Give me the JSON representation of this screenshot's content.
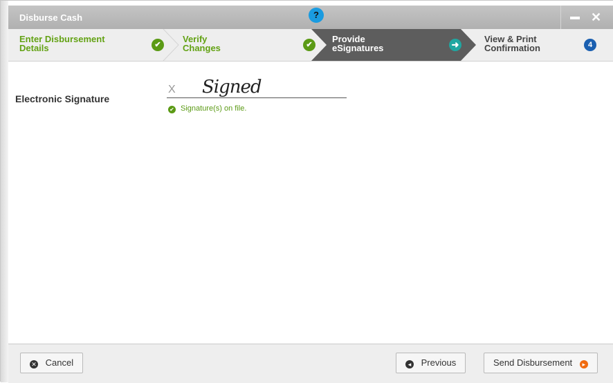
{
  "window": {
    "title": "Disburse Cash",
    "help_label": "?",
    "minimize_label": "—",
    "close_label": "✕"
  },
  "steps": [
    {
      "label_line1": "Enter Disbursement",
      "label_line2": "Details",
      "status": "done",
      "marker": "✔"
    },
    {
      "label_line1": "Verify",
      "label_line2": "Changes",
      "status": "done",
      "marker": "✔"
    },
    {
      "label_line1": "Provide",
      "label_line2": "eSignatures",
      "status": "active",
      "marker": "➜"
    },
    {
      "label_line1": "View & Print",
      "label_line2": "Confirmation",
      "status": "pending",
      "marker": "4"
    }
  ],
  "signature": {
    "label": "Electronic Signature",
    "x_mark": "X",
    "signed_text": "Signed",
    "status_text": "Signature(s) on file.",
    "status_icon": "check-circle-icon"
  },
  "footer": {
    "cancel_label": "Cancel",
    "previous_label": "Previous",
    "send_label": "Send Disbursement"
  },
  "colors": {
    "done_green": "#63a214",
    "active_step_bg": "#5f5f5f",
    "help_blue": "#1a9be0",
    "send_orange": "#f06a0f"
  }
}
